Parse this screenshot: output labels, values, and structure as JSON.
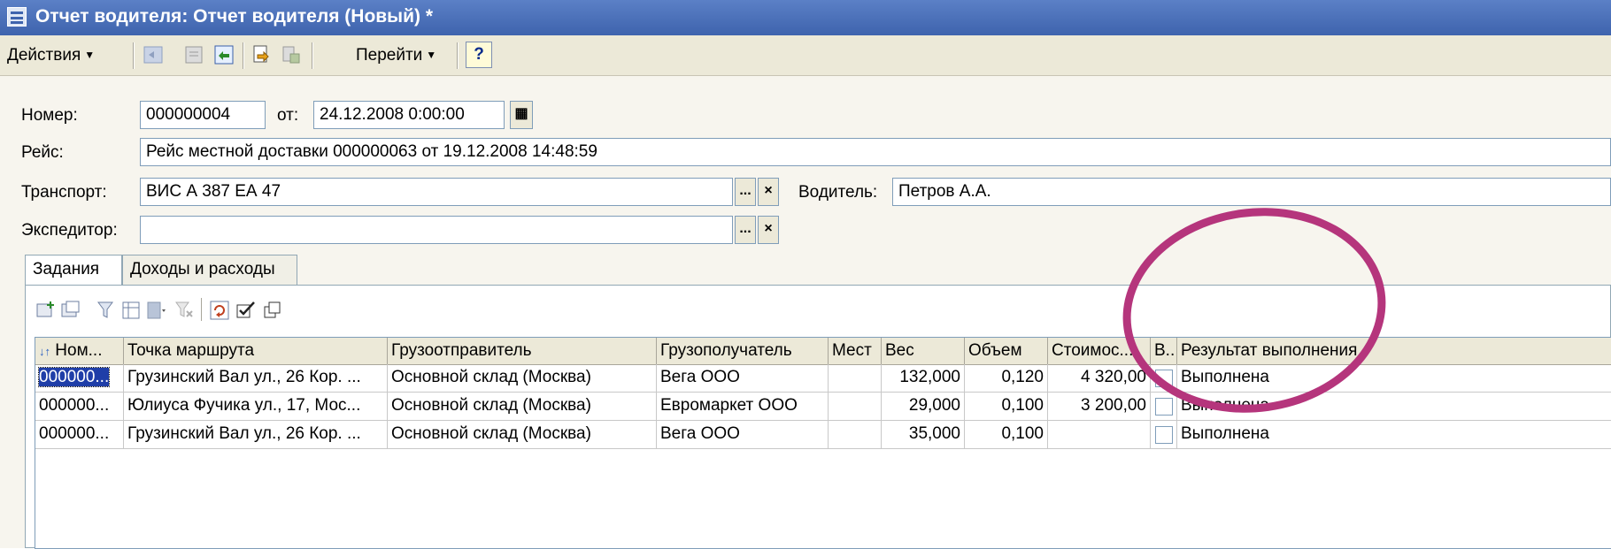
{
  "window": {
    "title": "Отчет водителя: Отчет водителя (Новый) *"
  },
  "toolbar": {
    "actions_label": "Действия",
    "goto_label": "Перейти",
    "help_label": "?"
  },
  "form": {
    "number_label": "Номер:",
    "number_value": "000000004",
    "from_label": "от:",
    "date_value": "24.12.2008  0:00:00",
    "trip_label": "Рейс:",
    "trip_value": "Рейс местной доставки 000000063 от 19.12.2008 14:48:59",
    "transport_label": "Транспорт:",
    "transport_value": "ВИС А 387 ЕА 47",
    "driver_label": "Водитель:",
    "driver_value": "Петров А.А.",
    "forwarder_label": "Экспедитор:",
    "forwarder_value": "",
    "select_glyph": "...",
    "clear_glyph": "×"
  },
  "tabs": [
    {
      "label": "Задания",
      "active": true
    },
    {
      "label": "Доходы и расходы",
      "active": false
    }
  ],
  "grid": {
    "columns": [
      "Ном...",
      "Точка маршрута",
      "Грузоотправитель",
      "Грузополучатель",
      "Мест",
      "Вес",
      "Объем",
      "Стоимос...",
      "В...",
      "Результат выполнения"
    ],
    "sort_glyph": "↓↑",
    "rows": [
      {
        "num": "000000...",
        "point": "Грузинский Вал ул., 26 Кор. ...",
        "sender": "Основной склад (Москва)",
        "receiver": "Вега ООО",
        "places": "",
        "weight": "132,000",
        "volume": "0,120",
        "cost": "4 320,00",
        "checked": false,
        "result": "Выполнена"
      },
      {
        "num": "000000...",
        "point": "Юлиуса Фучика ул., 17, Мос...",
        "sender": "Основной склад (Москва)",
        "receiver": "Евромаркет ООО",
        "places": "",
        "weight": "29,000",
        "volume": "0,100",
        "cost": "3 200,00",
        "checked": false,
        "result": "Выполнена"
      },
      {
        "num": "000000...",
        "point": "Грузинский Вал ул., 26 Кор. ...",
        "sender": "Основной склад (Москва)",
        "receiver": "Вега ООО",
        "places": "",
        "weight": "35,000",
        "volume": "0,100",
        "cost": "",
        "checked": false,
        "result": "Выполнена"
      }
    ]
  },
  "colors": {
    "title_bar": "#3e63ad",
    "annotation_ellipse": "#b5357c",
    "selection": "#1f3ea8"
  }
}
